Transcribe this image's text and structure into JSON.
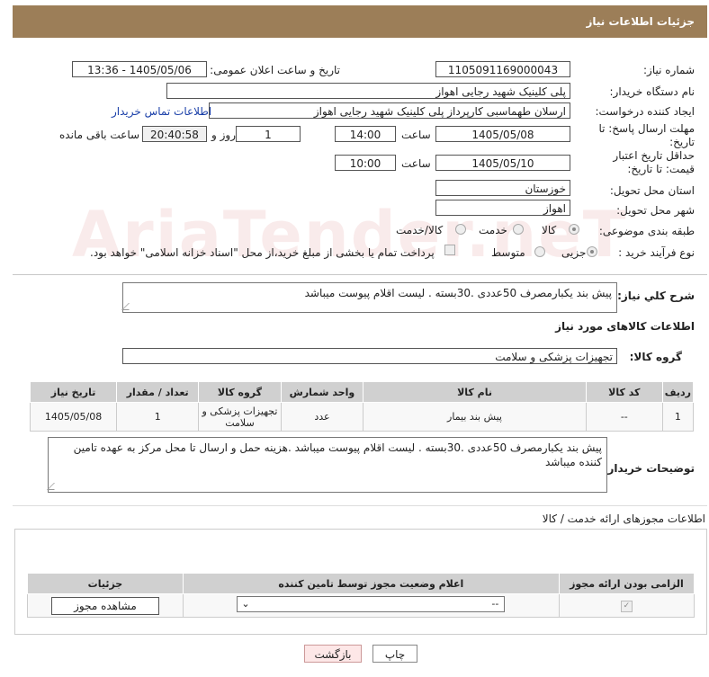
{
  "header": {
    "title": "جزئیات اطلاعات نیاز"
  },
  "watermark": "AriaTender.neT",
  "form": {
    "need_number_label": "شماره نیاز:",
    "need_number": "1105091169000043",
    "announce_label": "تاریخ و ساعت اعلان عمومی:",
    "announce_value": "1405/05/06 - 13:36",
    "buyer_org_label": "نام دستگاه خریدار:",
    "buyer_org": "پلی کلینیک شهید رجایی اهواز",
    "creator_label": "ایجاد کننده درخواست:",
    "creator": "ارسلان طهماسبی کارپرداز پلی کلینیک شهید رجایی اهواز",
    "contact_link": "اطلاعات تماس خریدار",
    "reply_deadline_label": "مهلت ارسال پاسخ: تا تاریخ:",
    "reply_date": "1405/05/08",
    "time_label": "ساعت",
    "reply_time": "14:00",
    "days_value": "1",
    "days_label": "روز و",
    "remaining_value": "20:40:58",
    "remaining_label": "ساعت باقی مانده",
    "validity_label": "حداقل تاریخ اعتبار قیمت: تا تاریخ:",
    "validity_date": "1405/05/10",
    "validity_time": "10:00",
    "province_label": "استان محل تحویل:",
    "province": "خوزستان",
    "city_label": "شهر محل تحویل:",
    "city": "اهواز",
    "category_label": "طبقه بندی موضوعی:",
    "category_options": [
      "کالا",
      "خدمت",
      "کالا/خدمت"
    ],
    "process_label": "نوع فرآیند خرید :",
    "process_options": [
      "جزیی",
      "متوسط"
    ],
    "payment_note": "پرداخت تمام یا بخشی از مبلغ خرید،از محل \"اسناد خزانه اسلامی\" خواهد بود."
  },
  "summary": {
    "label": "شرح کلي نياز:",
    "text": "پیش بند یکبارمصرف 50عددی .30بسته . لیست اقلام پیوست میباشد"
  },
  "goods_info_title": "اطلاعات کالاهای مورد نیاز",
  "goods_group": {
    "label": "گروه کالا:",
    "value": "تجهیزات پزشکی و سلامت"
  },
  "items_table": {
    "headers": [
      "ردیف",
      "کد کالا",
      "نام کالا",
      "واحد شمارش",
      "گروه کالا",
      "تعداد / مقدار",
      "تاریخ نیاز"
    ],
    "rows": [
      [
        "1",
        "--",
        "پیش بند بیمار",
        "عدد",
        "تجهیزات پزشکی و سلامت",
        "1",
        "1405/05/08"
      ]
    ]
  },
  "buyer_notes": {
    "label": "توضیحات خریدار:",
    "text": "پیش بند یکبارمصرف 50عددی .30بسته . لیست اقلام پیوست میباشد .هزینه حمل و ارسال تا محل مرکز به عهده تامین کننده میباشد"
  },
  "permits_title": "اطلاعات مجوزهای ارائه خدمت / کالا",
  "permits_table": {
    "headers": [
      "الزامی بودن ارائه مجوز",
      "اعلام وضعیت مجوز توسط تامین کننده",
      "جزئیات"
    ],
    "select_value": "--",
    "view_button": "مشاهده مجوز"
  },
  "buttons": {
    "print": "چاپ",
    "back": "بازگشت"
  }
}
